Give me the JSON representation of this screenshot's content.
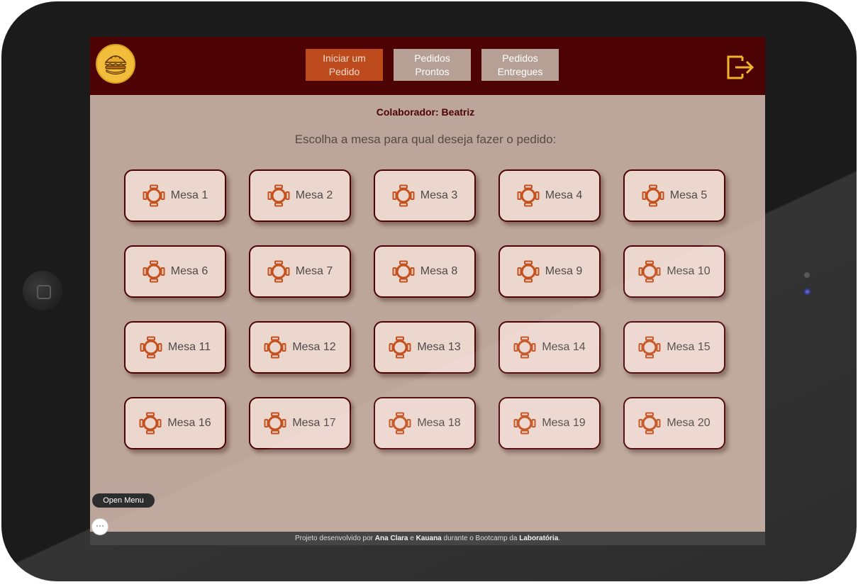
{
  "header": {
    "nav": [
      {
        "label": "Iniciar um Pedido",
        "active": true
      },
      {
        "label": "Pedidos Prontos",
        "active": false
      },
      {
        "label": "Pedidos Entregues",
        "active": false
      }
    ],
    "logout_icon": "logout-icon",
    "logo_icon": "burger-logo"
  },
  "main": {
    "collaborator": "Colaborador: Beatriz",
    "instruction": "Escolha a mesa para qual deseja fazer o pedido:",
    "tables": [
      {
        "label": "Mesa 1"
      },
      {
        "label": "Mesa 2"
      },
      {
        "label": "Mesa 3"
      },
      {
        "label": "Mesa 4"
      },
      {
        "label": "Mesa 5"
      },
      {
        "label": "Mesa 6"
      },
      {
        "label": "Mesa 7"
      },
      {
        "label": "Mesa 8"
      },
      {
        "label": "Mesa 9"
      },
      {
        "label": "Mesa 10"
      },
      {
        "label": "Mesa 11"
      },
      {
        "label": "Mesa 12"
      },
      {
        "label": "Mesa 13"
      },
      {
        "label": "Mesa 14"
      },
      {
        "label": "Mesa 15"
      },
      {
        "label": "Mesa 16"
      },
      {
        "label": "Mesa 17"
      },
      {
        "label": "Mesa 18"
      },
      {
        "label": "Mesa 19"
      },
      {
        "label": "Mesa 20"
      }
    ]
  },
  "footer": {
    "prefix": "Projeto desenvolvido por",
    "author1": "Ana Clara",
    "conj": "e",
    "author2": "Kauana",
    "middle": "durante o Bootcamp da",
    "org": "Laboratória",
    "suffix": "."
  },
  "overlay": {
    "open_menu": "Open Menu",
    "more": "···"
  },
  "colors": {
    "header_bg": "#4d0304",
    "active_btn": "#bd4a1d",
    "inactive_btn": "#b6a096",
    "page_bg": "#bca59a",
    "card_bg": "#ecd7cf",
    "icon_accent": "#c4501d",
    "logout_accent": "#f0b32b"
  }
}
